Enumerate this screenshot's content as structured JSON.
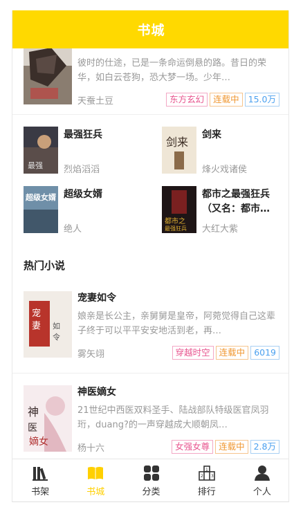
{
  "header": {
    "title": "书城"
  },
  "featured": [
    {
      "desc": "彼时的仕途，已是一条命运倒悬的路。昔日的荣华，如白云苍狗，恐大梦一场。少年…",
      "author": "天蚕土豆",
      "tags": [
        "东方玄幻",
        "连载中",
        "15.0万"
      ]
    }
  ],
  "grid": [
    {
      "title": "最强狂兵",
      "author": "烈焰滔滔"
    },
    {
      "title": "剑来",
      "author": "烽火戏诸侯"
    },
    {
      "title": "超级女婿",
      "author": "绝人"
    },
    {
      "title": "都市之最强狂兵（又名：都市…",
      "author": "大红大紫"
    }
  ],
  "hot_section": {
    "title": "热门小说"
  },
  "hot": [
    {
      "title": "宠妻如令",
      "desc": "娘亲是长公主，亲舅舅是皇帝，阿菀觉得自己这辈子终于可以平平安安地活到老，再…",
      "author": "雾矢翊",
      "tags": [
        "穿越时空",
        "连载中",
        "6019"
      ]
    },
    {
      "title": "神医嫡女",
      "desc": "21世纪中西医双料圣手、陆战部队特级医官凤羽珩，duang?的一声穿越成大顺朝凤…",
      "author": "杨十六",
      "tags": [
        "女强女尊",
        "连载中",
        "2.8万"
      ]
    }
  ],
  "tabbar": {
    "items": [
      {
        "label": "书架",
        "icon": "bookshelf-icon"
      },
      {
        "label": "书城",
        "icon": "open-book-icon",
        "active": true
      },
      {
        "label": "分类",
        "icon": "grid-icon"
      },
      {
        "label": "排行",
        "icon": "podium-icon"
      },
      {
        "label": "个人",
        "icon": "person-icon"
      }
    ]
  },
  "colors": {
    "accent": "#ffd900",
    "tag_pink": "#e8558f",
    "tag_orange": "#f0962e",
    "tag_blue": "#4aa0ef"
  }
}
